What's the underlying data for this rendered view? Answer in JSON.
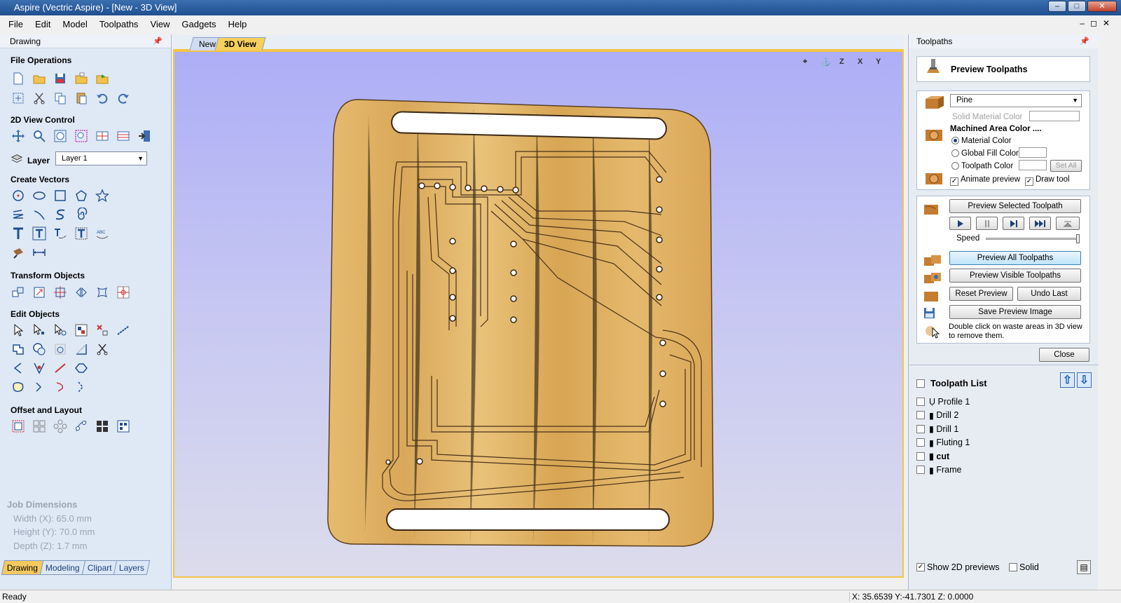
{
  "window": {
    "title": "Aspire (Vectric Aspire) - [New - 3D View]"
  },
  "menu": [
    "File",
    "Edit",
    "Model",
    "Toolpaths",
    "View",
    "Gadgets",
    "Help"
  ],
  "left_panel": {
    "title": "Drawing",
    "sections": {
      "file_operations": "File Operations",
      "view_control": "2D View Control",
      "create_vectors": "Create Vectors",
      "transform_objects": "Transform Objects",
      "edit_objects": "Edit Objects",
      "offset_layout": "Offset and Layout"
    },
    "layer_label": "Layer",
    "layer_value": "Layer 1",
    "job_dimensions": {
      "heading": "Job Dimensions",
      "width": "Width  (X): 65.0 mm",
      "height": "Height (Y): 70.0 mm",
      "depth": "Depth  (Z): 1.7 mm"
    },
    "tabs": [
      "Drawing",
      "Modeling",
      "Clipart",
      "Layers"
    ]
  },
  "doc_tabs": [
    "New",
    "3D View"
  ],
  "view_icons": [
    "⌖",
    "⚓",
    "Z",
    "X",
    "Y"
  ],
  "right_panel": {
    "title": "Toolpaths",
    "preview_title": "Preview Toolpaths",
    "material": "Pine",
    "solid_material_color": "Solid Material Color",
    "machined_area_color": "Machined Area Color ....",
    "radio_material_color": "Material Color",
    "radio_global_fill": "Global Fill Color",
    "radio_toolpath_color": "Toolpath Color",
    "set_all": "Set All",
    "animate_preview": "Animate preview",
    "draw_tool": "Draw tool",
    "preview_selected": "Preview Selected Toolpath",
    "speed": "Speed",
    "preview_all": "Preview All Toolpaths",
    "preview_visible": "Preview Visible Toolpaths",
    "reset_preview": "Reset Preview",
    "undo_last": "Undo Last",
    "save_preview_image": "Save Preview Image",
    "hint": "Double click on waste areas in 3D view to remove them.",
    "close": "Close",
    "toolpath_list_title": "Toolpath List",
    "toolpaths": [
      {
        "name": "Profile 1",
        "bold": false
      },
      {
        "name": "Drill 2",
        "bold": false
      },
      {
        "name": "Drill 1",
        "bold": false
      },
      {
        "name": "Fluting 1",
        "bold": false
      },
      {
        "name": "cut",
        "bold": true
      },
      {
        "name": "Frame",
        "bold": false
      }
    ],
    "show_2d_previews": "Show 2D previews",
    "solid": "Solid"
  },
  "status": {
    "text": "Ready",
    "coords": "X: 35.6539 Y:-41.7301 Z:  0.0000"
  }
}
